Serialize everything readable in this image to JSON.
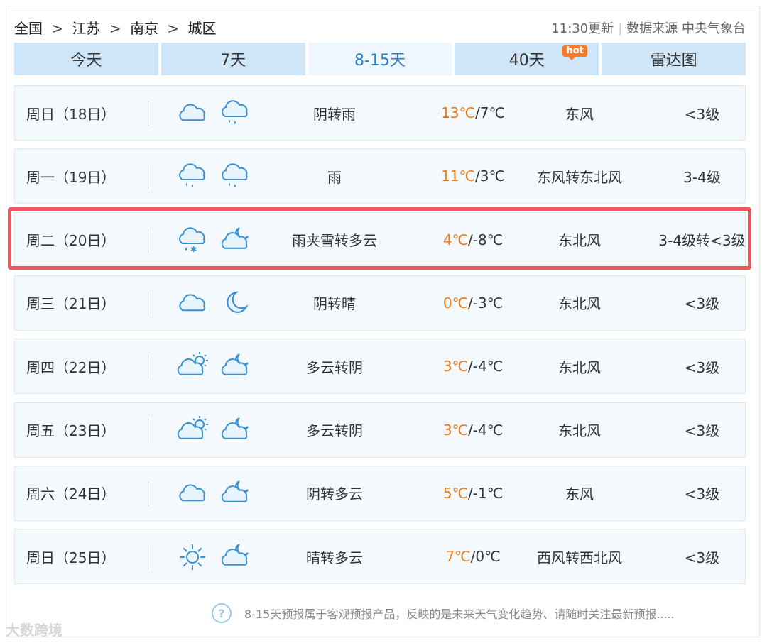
{
  "breadcrumb": [
    "全国",
    ">",
    "江苏",
    ">",
    "南京",
    ">",
    "城区"
  ],
  "meta": {
    "updated": "11:30更新",
    "source": "数据来源 中央气象台"
  },
  "tabs": [
    {
      "label": "今天",
      "active": false
    },
    {
      "label": "7天",
      "active": false
    },
    {
      "label": "8-15天",
      "active": true
    },
    {
      "label": "40天",
      "active": false,
      "badge": "hot"
    },
    {
      "label": "雷达图",
      "active": false
    }
  ],
  "rows": [
    {
      "date": "周日（18日）",
      "icons": [
        "cloudy-icon",
        "rain-icon"
      ],
      "desc": "阴转雨",
      "hi": "13℃",
      "lo": "/7℃",
      "wind": "东风",
      "level": "<3级"
    },
    {
      "date": "周一（19日）",
      "icons": [
        "rain-icon",
        "rain-icon"
      ],
      "desc": "雨",
      "hi": "11℃",
      "lo": "/3℃",
      "wind": "东风转东北风",
      "level": "3-4级"
    },
    {
      "date": "周二（20日）",
      "icons": [
        "sleet-icon",
        "partly-cloudy-night-icon"
      ],
      "desc": "雨夹雪转多云",
      "hi": "4℃",
      "lo": "/-8℃",
      "wind": "东北风",
      "level": "3-4级转<3级"
    },
    {
      "date": "周三（21日）",
      "icons": [
        "cloudy-icon",
        "moon-icon"
      ],
      "desc": "阴转晴",
      "hi": "0℃",
      "lo": "/-3℃",
      "wind": "东北风",
      "level": "<3级"
    },
    {
      "date": "周四（22日）",
      "icons": [
        "partly-cloudy-day-icon",
        "partly-cloudy-night-icon"
      ],
      "desc": "多云转阴",
      "hi": "3℃",
      "lo": "/-4℃",
      "wind": "东北风",
      "level": "<3级"
    },
    {
      "date": "周五（23日）",
      "icons": [
        "partly-cloudy-day-icon",
        "partly-cloudy-night-icon"
      ],
      "desc": "多云转阴",
      "hi": "3℃",
      "lo": "/-4℃",
      "wind": "东北风",
      "level": "<3级"
    },
    {
      "date": "周六（24日）",
      "icons": [
        "cloudy-icon",
        "partly-cloudy-night-icon"
      ],
      "desc": "阴转多云",
      "hi": "5℃",
      "lo": "/-1℃",
      "wind": "东风",
      "level": "<3级"
    },
    {
      "date": "周日（25日）",
      "icons": [
        "sun-icon",
        "partly-cloudy-night-icon"
      ],
      "desc": "晴转多云",
      "hi": "7℃",
      "lo": "/0℃",
      "wind": "西风转西北风",
      "level": "<3级"
    }
  ],
  "footer": {
    "help": "?",
    "note": "8-15天预报属于客观预报产品，反映的是未来天气变化趋势、请随时关注最新预报....."
  },
  "watermark": "大数跨境",
  "colors": {
    "accent": "#2e7cc7",
    "tab_bg": "#cfe6f8",
    "row_bg": "#f3f9fd",
    "high_temp": "#f07a18",
    "highlight": "#f0545c",
    "hot": "#f47b2a"
  }
}
